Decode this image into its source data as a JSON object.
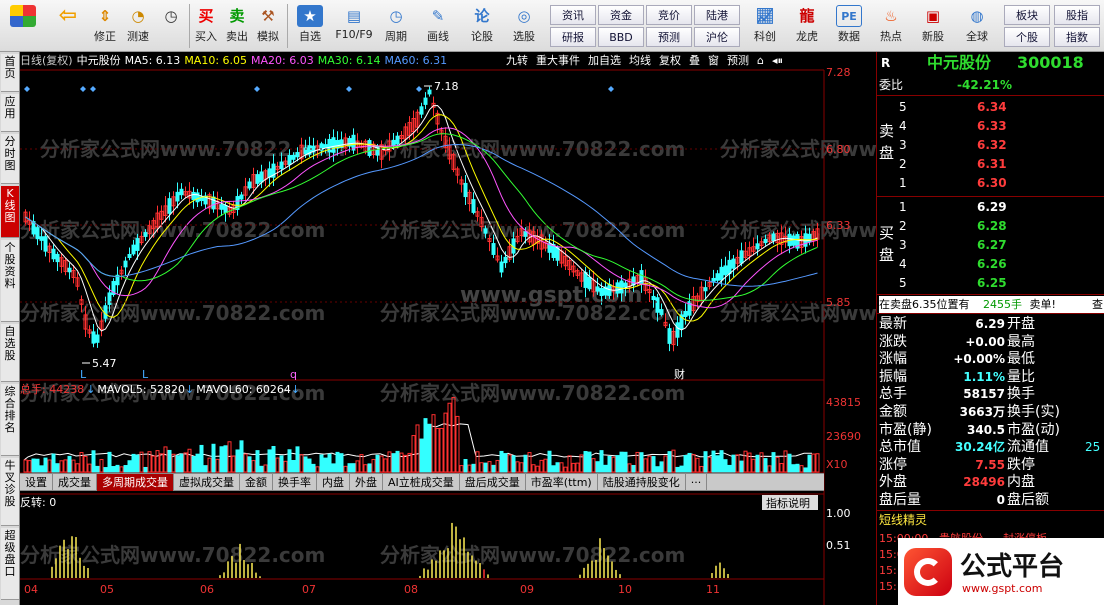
{
  "toolbar": {
    "buttons": [
      {
        "label": "",
        "icon": "grid-icon"
      },
      {
        "label": "",
        "icon": "back-arrow-icon"
      },
      {
        "label": "修正",
        "icon": "up-down-icon"
      },
      {
        "label": "测速",
        "icon": "speed-icon"
      },
      {
        "label": "买入",
        "icon": "buy-icon"
      },
      {
        "label": "卖出",
        "icon": "sell-icon"
      },
      {
        "label": "模拟",
        "icon": "hammer-icon"
      },
      {
        "label": "自选",
        "icon": "star-icon"
      },
      {
        "label": "F10/F9",
        "icon": "f10-icon"
      },
      {
        "label": "周期",
        "icon": "period-icon"
      },
      {
        "label": "画线",
        "icon": "pen-icon"
      },
      {
        "label": "论股",
        "icon": "discuss-icon"
      },
      {
        "label": "选股",
        "icon": "select-stock-icon"
      }
    ],
    "small_buttons": [
      "资讯",
      "资金",
      "竞价",
      "陆港",
      "研报",
      "BBD",
      "预测",
      "沪伦"
    ],
    "right_buttons": [
      {
        "label": "科创",
        "icon": "chart-icon"
      },
      {
        "label": "龙虎",
        "icon": "dragon-icon"
      },
      {
        "label": "数据",
        "icon": "pe-icon"
      },
      {
        "label": "热点",
        "icon": "fire-icon"
      },
      {
        "label": "新股",
        "icon": "new-stock-icon"
      },
      {
        "label": "全球",
        "icon": "globe-icon"
      }
    ],
    "far_right": [
      "板块",
      "股指",
      "个股",
      "指数"
    ]
  },
  "rail_tabs": [
    "首页",
    "应用",
    "分时图",
    "K线图",
    "个股资料",
    "自选股",
    "综合排名",
    "牛叉诊股",
    "超级盘口"
  ],
  "kline": {
    "header": {
      "period": "日线(复权)",
      "stock": "中元股份",
      "ma5": "MA5: 6.13",
      "ma10": "MA10: 6.05",
      "ma20": "MA20: 6.03",
      "ma30": "MA30: 6.14",
      "ma60": "MA60: 6.31"
    },
    "buttons": [
      "九转",
      "重大事件",
      "加自选",
      "均线",
      "复权",
      "叠",
      "窗",
      "预测"
    ],
    "price_ticks": [
      "7.28",
      "6.80",
      "6.33",
      "5.85"
    ],
    "high_label": "7.18",
    "low_label": "5.47",
    "markers": [
      "L",
      "L",
      "q",
      "财"
    ],
    "watermark_main": "www.gspt.com",
    "watermark_repeat": "分析家公式网www.70822.com",
    "volume_header": {
      "total": "总手: 44238",
      "mavol5": "MAVOL5: 52820",
      "mavol60": "MAVOL60: 60264"
    },
    "volume_ticks": [
      "43815",
      "23690",
      "X10"
    ],
    "indicator_label": "反转: 0",
    "indicator_button": "指标说明",
    "indicator_ticks": [
      "1.00",
      "0.51"
    ],
    "month_labels": [
      "04",
      "05",
      "06",
      "07",
      "08",
      "09",
      "10",
      "11"
    ]
  },
  "bottom_tabs": [
    "设置",
    "成交量",
    "多周期成交量",
    "虚拟成交量",
    "金额",
    "换手率",
    "内盘",
    "外盘",
    "AI立桩成交量",
    "盘后成交量",
    "市盈率(ttm)",
    "陆股通持股变化",
    "···"
  ],
  "quote": {
    "badge": "R",
    "name": "中元股份",
    "code": "300018",
    "weibi_label": "委比",
    "weibi_value": "-42.21%",
    "sell_label": "卖盘",
    "buy_label": "买盘",
    "sells": [
      {
        "lvl": "5",
        "price": "6.34"
      },
      {
        "lvl": "4",
        "price": "6.33"
      },
      {
        "lvl": "3",
        "price": "6.32"
      },
      {
        "lvl": "2",
        "price": "6.31"
      },
      {
        "lvl": "1",
        "price": "6.30"
      }
    ],
    "buys": [
      {
        "lvl": "1",
        "price": "6.29"
      },
      {
        "lvl": "2",
        "price": "6.28"
      },
      {
        "lvl": "3",
        "price": "6.27"
      },
      {
        "lvl": "4",
        "price": "6.26"
      },
      {
        "lvl": "5",
        "price": "6.25"
      }
    ],
    "ticker_line": "在卖盘6.35位置有",
    "ticker_vol": "2455手",
    "ticker_tail": "卖单!",
    "ticker_more": "查",
    "stats": [
      {
        "k": "最新",
        "v": "6.29",
        "k2": "开盘"
      },
      {
        "k": "涨跌",
        "v": "+0.00",
        "k2": "最高"
      },
      {
        "k": "涨幅",
        "v": "+0.00%",
        "k2": "最低"
      },
      {
        "k": "振幅",
        "v": "1.11%",
        "k2": "量比"
      },
      {
        "k": "总手",
        "v": "58157",
        "k2": "换手"
      },
      {
        "k": "金额",
        "v": "3663万",
        "k2": "换手(实)"
      },
      {
        "k": "市盈(静)",
        "v": "340.5",
        "k2": "市盈(动)"
      },
      {
        "k": "总市值",
        "v": "30.24亿",
        "k2": "流通值",
        "v2": "25"
      },
      {
        "k": "涨停",
        "v": "7.55",
        "k2": "跌停"
      },
      {
        "k": "外盘",
        "v": "28496",
        "k2": "内盘"
      },
      {
        "k": "盘后量",
        "v": "0",
        "k2": "盘后额"
      }
    ],
    "short_title": "短线精灵",
    "short_rows": [
      {
        "t": "15:00:00",
        "name": "贵航股份",
        "ev": "封涨停板"
      },
      {
        "t": "15:00:00",
        "name": "",
        "ev": ""
      },
      {
        "t": "15:",
        "name": "",
        "ev": ""
      },
      {
        "t": "15:",
        "name": "",
        "ev": ""
      }
    ]
  },
  "logo": {
    "brand": "公式平台",
    "url": "www.gspt.com"
  }
}
